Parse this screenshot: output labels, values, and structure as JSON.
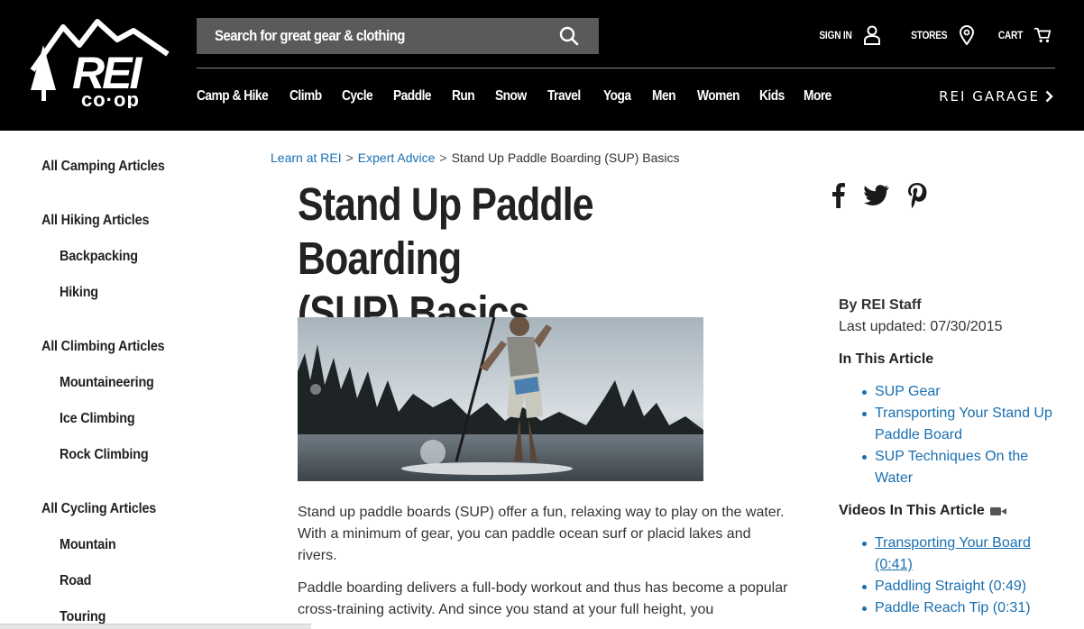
{
  "header": {
    "search_placeholder": "Search for great gear & clothing",
    "sign_in": "SIGN IN",
    "stores": "STORES",
    "cart": "CART",
    "nav": [
      "Camp & Hike",
      "Climb",
      "Cycle",
      "Paddle",
      "Run",
      "Snow",
      "Travel",
      "Yoga",
      "Men",
      "Women",
      "Kids",
      "More"
    ],
    "garage": "REI GARAGE"
  },
  "sidebar": {
    "items": [
      {
        "label": "All Camping Articles",
        "sub": false
      },
      {
        "label": "All Hiking Articles",
        "sub": false
      },
      {
        "label": "Backpacking",
        "sub": true
      },
      {
        "label": "Hiking",
        "sub": true
      },
      {
        "label": "All Climbing Articles",
        "sub": false
      },
      {
        "label": "Mountaineering",
        "sub": true
      },
      {
        "label": "Ice Climbing",
        "sub": true
      },
      {
        "label": "Rock Climbing",
        "sub": true
      },
      {
        "label": "All Cycling Articles",
        "sub": false
      },
      {
        "label": "Mountain",
        "sub": true
      },
      {
        "label": "Road",
        "sub": true
      },
      {
        "label": "Touring",
        "sub": true
      }
    ]
  },
  "breadcrumb": {
    "link1": "Learn at REI",
    "link2": "Expert Advice",
    "current": "Stand Up Paddle Boarding (SUP) Basics",
    "separator": ">"
  },
  "article": {
    "title_line1": "Stand Up Paddle Boarding",
    "title_line2": "(SUP) Basics",
    "para1": "Stand up paddle boards (SUP) offer a fun, relaxing way to play on the water. With a minimum of gear, you can paddle ocean surf or placid lakes and rivers.",
    "para2": "Paddle boarding delivers a full-body workout and thus has become a popular cross-training activity. And since you stand at your full height, you"
  },
  "meta": {
    "author": "By REI Staff",
    "updated": "Last updated: 07/30/2015"
  },
  "in_this_article": {
    "heading": "In This Article",
    "links": [
      "SUP Gear",
      "Transporting Your Stand Up Paddle Board",
      "SUP Techniques On the Water"
    ]
  },
  "videos": {
    "heading": "Videos In This Article",
    "links": [
      "Transporting Your Board (0:41)",
      "Paddling Straight (0:49)",
      "Paddle Reach Tip (0:31)"
    ]
  },
  "colors": {
    "header_bg": "#000000",
    "link": "#1a6fb0",
    "search_bg": "#5a5a5a"
  }
}
